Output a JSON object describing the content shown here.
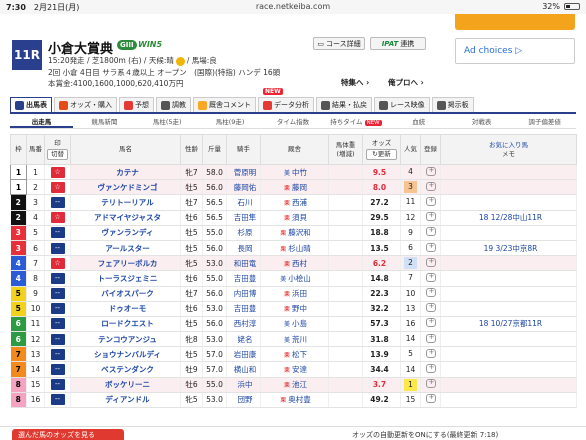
{
  "status": {
    "time": "7:30",
    "date": "2月21日(月)",
    "url": "race.netkeiba.com",
    "battery": "32%"
  },
  "race": {
    "number": "11R",
    "title": "小倉大賞典",
    "grade": "GIII",
    "win5": "WIN5",
    "info1_a": "15:20発走 / 芝1800m (右) / 天候:晴",
    "info1_b": "/ 馬場:良",
    "info2": "2回 小倉 4日目 サラ系４歳以上 オープン　(国際)(特指) ハンデ 16頭",
    "info3": "本賞金:4100,1600,1000,620,410万円",
    "course_btn": "コース詳細",
    "ipat_logo": "IPAT",
    "ipat_btn": "連携",
    "tokushu": "特集へ ›",
    "pro": "俺プロへ ›",
    "adchoices": "Ad choices ▷"
  },
  "tabs": [
    {
      "label": "出馬表",
      "color": "#2b3f8f"
    },
    {
      "label": "オッズ・購入",
      "color": "#e64a19"
    },
    {
      "label": "予想",
      "color": "#e53935"
    },
    {
      "label": "調教",
      "color": "#555"
    },
    {
      "label": "厩舎コメント",
      "color": "#f9a825"
    },
    {
      "label": "データ分析",
      "color": "#e53935",
      "badge": "NEW"
    },
    {
      "label": "結果・払戻",
      "color": "#555"
    },
    {
      "label": "レース映像",
      "color": "#555"
    },
    {
      "label": "掲示板",
      "color": "#555"
    }
  ],
  "subtabs": [
    "出走馬",
    "競馬新聞",
    "馬柱(5走)",
    "馬柱(9走)",
    "タイム指数",
    "持ちタイム",
    "血統",
    "対戦表",
    "調子偏差値"
  ],
  "subtab_new": "NEW",
  "headers": {
    "waku": "枠",
    "num": "馬番",
    "mark": "印",
    "mark_switch": "切替",
    "name": "馬名",
    "sexage": "性齢",
    "weight": "斤量",
    "jockey": "騎手",
    "trainer": "厩舎",
    "bodyweight": "馬体重",
    "bodyweight2": "(増減)",
    "odds": "オッズ",
    "odds_update": "更新",
    "pop": "人気",
    "reg": "登録",
    "fav": "お気に入り馬",
    "memo": "メモ"
  },
  "colors": {
    "waku": [
      "#ffffff",
      "#111111",
      "#e8303a",
      "#2b5bd6",
      "#f2d21b",
      "#2e9a44",
      "#f28a1d",
      "#f4a3c0"
    ],
    "waku_text": [
      "#000000",
      "#ffffff",
      "#ffffff",
      "#ffffff",
      "#000000",
      "#ffffff",
      "#000000",
      "#000000"
    ]
  },
  "rows": [
    {
      "waku": "1",
      "num": "1",
      "mark": "☆",
      "name": "カテナ",
      "sexage": "牝7",
      "weight": "58.0",
      "jockey": "菅原明",
      "reg": "美",
      "trainer": "中竹",
      "odds": "9.5",
      "pop": "4",
      "memo": ""
    },
    {
      "waku": "1",
      "num": "2",
      "mark": "☆",
      "name": "ヴァンケドミンゴ",
      "sexage": "牡5",
      "weight": "56.0",
      "jockey": "藤岡佑",
      "reg": "栗",
      "trainer": "藤岡",
      "odds": "8.0",
      "pop": "3",
      "memo": ""
    },
    {
      "waku": "2",
      "num": "3",
      "mark": "--",
      "name": "テリトーリアル",
      "sexage": "牡7",
      "weight": "56.5",
      "jockey": "石川",
      "reg": "栗",
      "trainer": "西浦",
      "odds": "27.2",
      "pop": "11",
      "memo": ""
    },
    {
      "waku": "2",
      "num": "4",
      "mark": "☆",
      "name": "アドマイヤジャスタ",
      "sexage": "牡6",
      "weight": "56.5",
      "jockey": "吉田隼",
      "reg": "栗",
      "trainer": "須貝",
      "odds": "29.5",
      "pop": "12",
      "memo": "18 12/28中山11R"
    },
    {
      "waku": "3",
      "num": "5",
      "mark": "--",
      "name": "ヴァンランディ",
      "sexage": "牡5",
      "weight": "55.0",
      "jockey": "杉原",
      "reg": "栗",
      "trainer": "藤沢和",
      "odds": "18.8",
      "pop": "9",
      "memo": ""
    },
    {
      "waku": "3",
      "num": "6",
      "mark": "--",
      "name": "アールスター",
      "sexage": "牡5",
      "weight": "56.0",
      "jockey": "長岡",
      "reg": "栗",
      "trainer": "杉山晴",
      "odds": "13.5",
      "pop": "6",
      "memo": "19 3/23中京8R"
    },
    {
      "waku": "4",
      "num": "7",
      "mark": "☆",
      "name": "フェアリーポルカ",
      "sexage": "牝5",
      "weight": "53.0",
      "jockey": "和田竜",
      "reg": "栗",
      "trainer": "西村",
      "odds": "6.2",
      "pop": "2",
      "memo": ""
    },
    {
      "waku": "4",
      "num": "8",
      "mark": "--",
      "name": "トーラスジェミニ",
      "sexage": "牡6",
      "weight": "55.0",
      "jockey": "吉田豊",
      "reg": "美",
      "trainer": "小桧山",
      "odds": "14.8",
      "pop": "7",
      "memo": ""
    },
    {
      "waku": "5",
      "num": "9",
      "mark": "--",
      "name": "バイオスパーク",
      "sexage": "牡7",
      "weight": "56.0",
      "jockey": "内田博",
      "reg": "栗",
      "trainer": "浜田",
      "odds": "22.3",
      "pop": "10",
      "memo": ""
    },
    {
      "waku": "5",
      "num": "10",
      "mark": "--",
      "name": "ドゥオーモ",
      "sexage": "牡6",
      "weight": "53.0",
      "jockey": "吉田豊",
      "reg": "栗",
      "trainer": "野中",
      "odds": "32.2",
      "pop": "13",
      "memo": ""
    },
    {
      "waku": "6",
      "num": "11",
      "mark": "--",
      "name": "ロードクエスト",
      "sexage": "牡5",
      "weight": "56.0",
      "jockey": "西村淳",
      "reg": "美",
      "trainer": "小島",
      "odds": "57.3",
      "pop": "16",
      "memo": "18 10/27京都11R"
    },
    {
      "waku": "6",
      "num": "12",
      "mark": "--",
      "name": "テンコウアンジュ",
      "sexage": "牝8",
      "weight": "53.0",
      "jockey": "姥名",
      "reg": "美",
      "trainer": "荒川",
      "odds": "31.8",
      "pop": "14",
      "memo": ""
    },
    {
      "waku": "7",
      "num": "13",
      "mark": "--",
      "name": "ショウナンバルディ",
      "sexage": "牡5",
      "weight": "57.0",
      "jockey": "岩田康",
      "reg": "栗",
      "trainer": "松下",
      "odds": "13.9",
      "pop": "5",
      "memo": ""
    },
    {
      "waku": "7",
      "num": "14",
      "mark": "--",
      "name": "ベステンダンク",
      "sexage": "牡9",
      "weight": "57.0",
      "jockey": "横山和",
      "reg": "栗",
      "trainer": "安達",
      "odds": "34.4",
      "pop": "14",
      "memo": ""
    },
    {
      "waku": "8",
      "num": "15",
      "mark": "--",
      "name": "ボッケリーニ",
      "sexage": "牡6",
      "weight": "55.0",
      "jockey": "浜中",
      "reg": "栗",
      "trainer": "池江",
      "odds": "3.7",
      "pop": "1",
      "memo": ""
    },
    {
      "waku": "8",
      "num": "16",
      "mark": "--",
      "name": "ディアンドル",
      "sexage": "牝5",
      "weight": "53.0",
      "jockey": "団野",
      "reg": "栗",
      "trainer": "奥村豊",
      "odds": "49.2",
      "pop": "15",
      "memo": ""
    }
  ],
  "bottom": {
    "button": "選んだ馬のオッズを見る",
    "note": "オッズの自動更新をONにする(最終更新 7:18)"
  }
}
